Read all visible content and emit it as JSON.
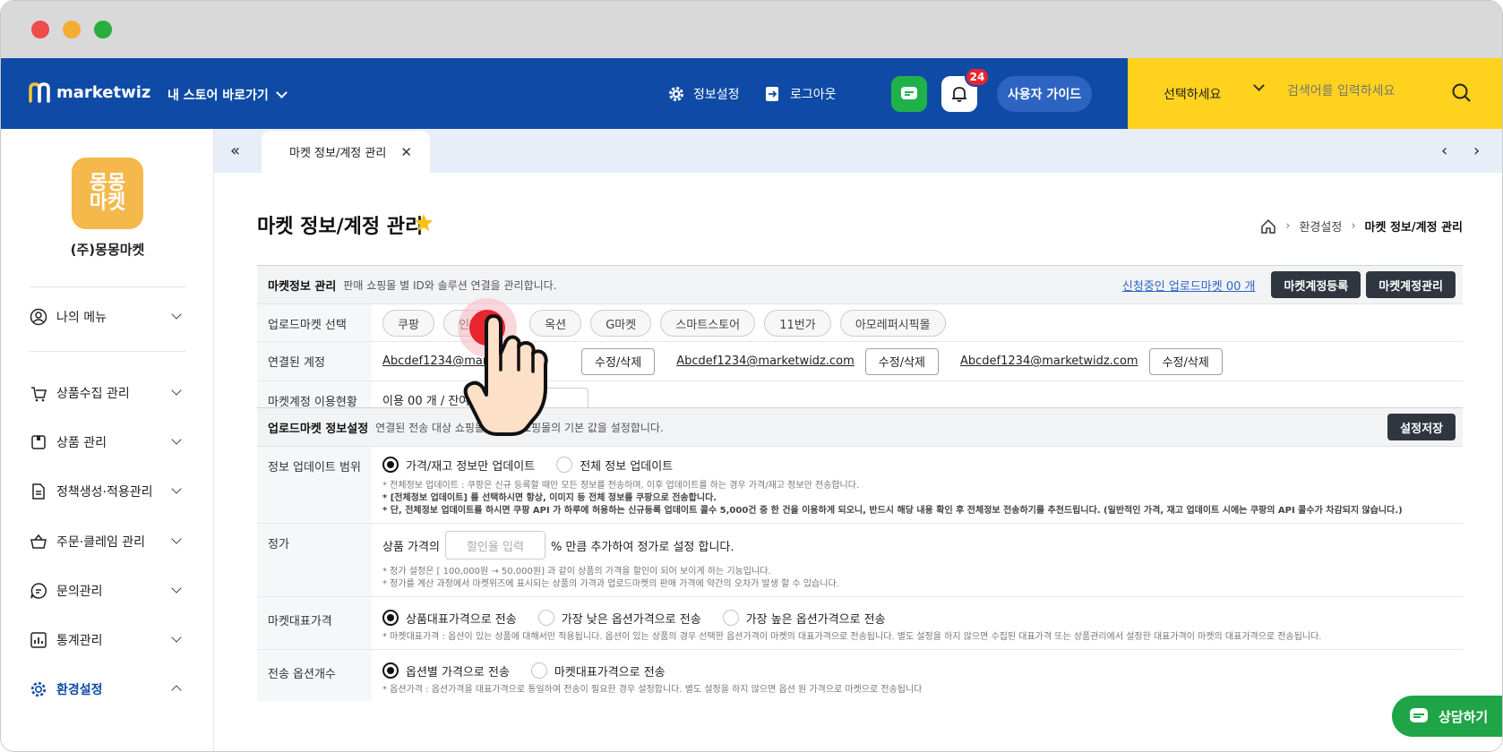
{
  "header": {
    "logo_text": "marketwiz",
    "store_link": "내 스토어 바로가기",
    "settings_label": "정보설정",
    "logout_label": "로그아웃",
    "notification_count": "24",
    "guide_label": "사용자 가이드",
    "search_select": "선택하세요",
    "search_placeholder": "검색어를 입력하세요"
  },
  "sidebar": {
    "brand_logo_text": "몽몽\n마켓",
    "brand_name": "(주)몽몽마켓",
    "my_menu": "나의 메뉴",
    "items": [
      {
        "label": "상품수집 관리"
      },
      {
        "label": "상품 관리"
      },
      {
        "label": "정책생성·적용관리"
      },
      {
        "label": "주문·클레임 관리"
      },
      {
        "label": "문의관리"
      },
      {
        "label": "통계관리"
      },
      {
        "label": "환경설정"
      }
    ]
  },
  "tabs": {
    "active_label": "마켓 정보/계정 관리"
  },
  "page": {
    "title": "마켓 정보/계정 관리",
    "breadcrumb": [
      "환경설정",
      "마켓 정보/계정 관리"
    ]
  },
  "market_info": {
    "title": "마켓정보 관리",
    "desc": "판매 쇼핑몰 별 ID와 솔루션 연결을 관리합니다.",
    "applying_link": "신청중인 업로드마켓 00 개",
    "register_btn": "마켓계정등록",
    "manage_btn": "마켓계정관리",
    "select_label": "업로드마켓 선택",
    "markets": [
      "쿠팡",
      "인터",
      "옥션",
      "G마켓",
      "스마트스토어",
      "11번가",
      "아모레퍼시픽몰"
    ],
    "linked_label": "연결된 계정",
    "accounts": [
      {
        "email": "Abcdef1234@marketw",
        "btn": "수정/삭제"
      },
      {
        "email": "Abcdef1234@marketwidz.com",
        "btn": "수정/삭제"
      },
      {
        "email": "Abcdef1234@marketwidz.com",
        "btn": "수정/삭제"
      }
    ],
    "usage_label": "마켓계정 이용현황",
    "usage_value": "이용 00 개 / 잔여 00 개"
  },
  "upload_settings": {
    "title": "업로드마켓 정보설정",
    "desc": "연결된 전송 대상 쇼핑몰/임대형 쇼핑몰의 기본 값을 설정합니다.",
    "save_btn": "설정저장",
    "update_label": "정보 업데이트 범위",
    "update_opt1": "가격/재고 정보만 업데이트",
    "update_opt2": "전체 정보 업데이트",
    "update_note1": "* 전체정보 업데이트 : 쿠팡은 신규 등록할 때만 모든 정보를 전송하며, 이후 업데이트를 하는 경우 가격/재고 정보만 전송합니다.",
    "update_note2": "* [전체정보 업데이트] 를 선택하시면 항상, 이미지 등 전체 정보를 쿠팡으로 전송합니다.",
    "update_note3": "* 단, 전체정보 업데이트를 하시면 쿠팡 API 가 하루에 허용하는 신규등록 업데이트 콜수 5,000건 중 한 건을 이용하게 되오니, 반드시 해당 내용 확인 후 전체정보 전송하기를 추천드립니다. (일반적인 가격, 재고 업데이트 시에는 쿠팡의 API 콜수가 차감되지 않습니다.)",
    "price_label": "정가",
    "price_prefix": "상품 가격의",
    "price_placeholder": "할인율 입력",
    "price_suffix": "% 만큼 추가하여 정가로 설정 합니다.",
    "price_note1": "* 정가 설정은 [ 100,000원 → 50,000원] 과 같이 상품의 가격을 할인이 되어 보이게 하는 기능입니다.",
    "price_note2": "* 정가를 계산 과정에서 마켓위즈에 표시되는 상품의 가격과 업로드마켓의 판매 가격에 약간의 오차가 발생 할 수 있습니다.",
    "rep_label": "마켓대표가격",
    "rep_opt1": "상품대표가격으로 전송",
    "rep_opt2": "가장 낮은 옵션가격으로 전송",
    "rep_opt3": "가장 높은 옵션가격으로 전송",
    "rep_note": "* 마켓대표가격 : 옵션이 있는 상품에 대해서만 적용됩니다. 옵션이 있는 상품의 경우 선택한 옵션가격이 마켓의 대표가격으로 전송됩니다. 별도 설정을 하지 않으면 수집된 대표가격 또는 상품관리에서 설정한 대표가격이 마켓의 대표가격으로 전송됩니다.",
    "opt_label": "전송 옵션개수",
    "opt_opt1": "옵션별 가격으로 전송",
    "opt_opt2": "마켓대표가격으로 전송",
    "opt_note": "* 옵션가격 : 옵션가격을 대표가격으로 통일하여 전송이 필요한 경우 설정합니다. 별도 설정을 하지 않으면 옵션 원 가격으로 마켓으로 전송됩니다"
  },
  "chat": {
    "label": "상담하기"
  },
  "colors": {
    "header_blue": "#0f4ba6",
    "search_yellow": "#ffd21e",
    "chat_green": "#1fa547",
    "badge_red": "#e8242d",
    "touch_red": "#e8242d"
  }
}
